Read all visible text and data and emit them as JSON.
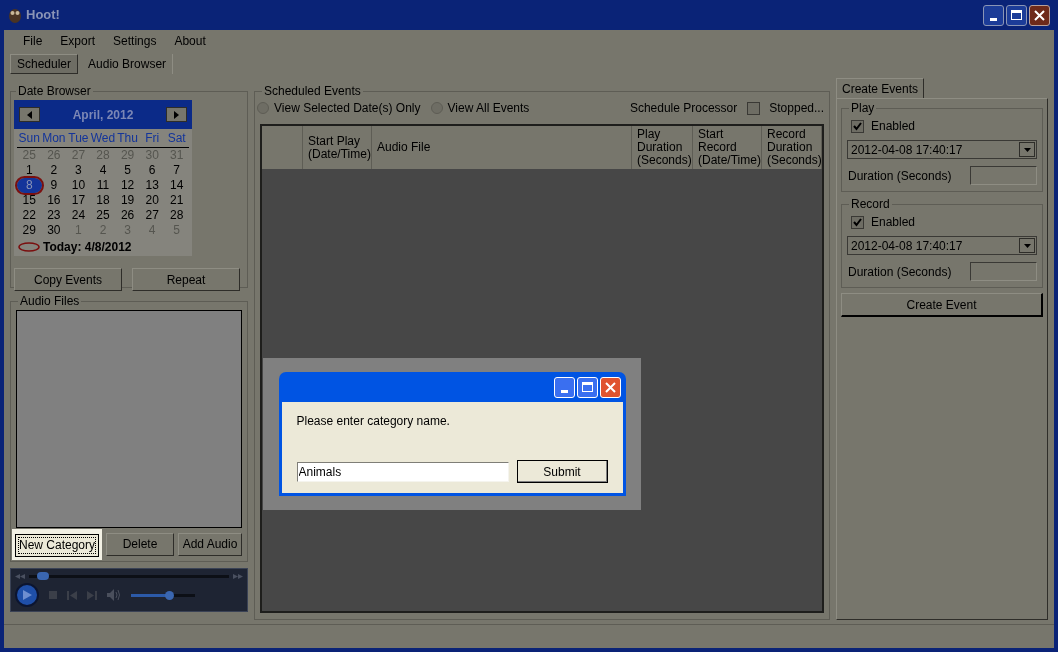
{
  "window": {
    "title": "Hoot!"
  },
  "menu": [
    "File",
    "Export",
    "Settings",
    "About"
  ],
  "tabs": [
    {
      "label": "Scheduler",
      "selected": true
    },
    {
      "label": "Audio Browser",
      "selected": false
    }
  ],
  "date_browser": {
    "title": "Date Browser",
    "month": "April, 2012",
    "weekdays": [
      "Sun",
      "Mon",
      "Tue",
      "Wed",
      "Thu",
      "Fri",
      "Sat"
    ],
    "weeks": [
      [
        {
          "day": "25",
          "muted": true,
          "selected": false
        },
        {
          "day": "26",
          "muted": true,
          "selected": false
        },
        {
          "day": "27",
          "muted": true,
          "selected": false
        },
        {
          "day": "28",
          "muted": true,
          "selected": false
        },
        {
          "day": "29",
          "muted": true,
          "selected": false
        },
        {
          "day": "30",
          "muted": true,
          "selected": false
        },
        {
          "day": "31",
          "muted": true,
          "selected": false
        }
      ],
      [
        {
          "day": "1",
          "muted": false,
          "selected": false
        },
        {
          "day": "2",
          "muted": false,
          "selected": false
        },
        {
          "day": "3",
          "muted": false,
          "selected": false
        },
        {
          "day": "4",
          "muted": false,
          "selected": false
        },
        {
          "day": "5",
          "muted": false,
          "selected": false
        },
        {
          "day": "6",
          "muted": false,
          "selected": false
        },
        {
          "day": "7",
          "muted": false,
          "selected": false
        }
      ],
      [
        {
          "day": "8",
          "muted": false,
          "selected": true
        },
        {
          "day": "9",
          "muted": false,
          "selected": false
        },
        {
          "day": "10",
          "muted": false,
          "selected": false
        },
        {
          "day": "11",
          "muted": false,
          "selected": false
        },
        {
          "day": "12",
          "muted": false,
          "selected": false
        },
        {
          "day": "13",
          "muted": false,
          "selected": false
        },
        {
          "day": "14",
          "muted": false,
          "selected": false
        }
      ],
      [
        {
          "day": "15",
          "muted": false,
          "selected": false
        },
        {
          "day": "16",
          "muted": false,
          "selected": false
        },
        {
          "day": "17",
          "muted": false,
          "selected": false
        },
        {
          "day": "18",
          "muted": false,
          "selected": false
        },
        {
          "day": "19",
          "muted": false,
          "selected": false
        },
        {
          "day": "20",
          "muted": false,
          "selected": false
        },
        {
          "day": "21",
          "muted": false,
          "selected": false
        }
      ],
      [
        {
          "day": "22",
          "muted": false,
          "selected": false
        },
        {
          "day": "23",
          "muted": false,
          "selected": false
        },
        {
          "day": "24",
          "muted": false,
          "selected": false
        },
        {
          "day": "25",
          "muted": false,
          "selected": false
        },
        {
          "day": "26",
          "muted": false,
          "selected": false
        },
        {
          "day": "27",
          "muted": false,
          "selected": false
        },
        {
          "day": "28",
          "muted": false,
          "selected": false
        }
      ],
      [
        {
          "day": "29",
          "muted": false,
          "selected": false
        },
        {
          "day": "30",
          "muted": false,
          "selected": false
        },
        {
          "day": "1",
          "muted": true,
          "selected": false
        },
        {
          "day": "2",
          "muted": true,
          "selected": false
        },
        {
          "day": "3",
          "muted": true,
          "selected": false
        },
        {
          "day": "4",
          "muted": true,
          "selected": false
        },
        {
          "day": "5",
          "muted": true,
          "selected": false
        }
      ]
    ],
    "today": "Today: 4/8/2012",
    "buttons": [
      "Copy Events",
      "Repeat"
    ]
  },
  "audio_files": {
    "title": "Audio Files",
    "buttons": [
      {
        "label": "New Category",
        "highlighted": true
      },
      {
        "label": "Delete",
        "highlighted": false
      },
      {
        "label": "Add Audio",
        "highlighted": false
      }
    ]
  },
  "player": {
    "seek": {
      "level": 0.05
    },
    "volume": {
      "level": 0.6
    }
  },
  "scheduled_events": {
    "title": "Scheduled Events",
    "filters": [
      {
        "label": "View Selected Date(s) Only",
        "selected": false
      },
      {
        "label": "View All Events",
        "selected": false
      }
    ],
    "processor_label": "Schedule Processor",
    "stopped": {
      "label": "Stopped...",
      "checked": false
    },
    "columns": [
      "Start Play (Date/Time)",
      "Audio File",
      "Play Duration (Seconds)",
      "Start Record (Date/Time)",
      "Record Duration (Seconds)"
    ]
  },
  "create_events": {
    "tab": {
      "label": "Create Events"
    },
    "groups": [
      {
        "title": "Play",
        "enabled": {
          "label": "Enabled",
          "checked": true
        },
        "datetime": "2012-04-08 17:40:17",
        "duration_label": "Duration (Seconds)"
      },
      {
        "title": "Record",
        "enabled": {
          "label": "Enabled",
          "checked": true
        },
        "datetime": "2012-04-08 17:40:17",
        "duration_label": "Duration (Seconds)"
      }
    ],
    "button": "Create Event"
  },
  "dialog": {
    "message": "Please enter category name.",
    "value": "Animals",
    "button": "Submit"
  }
}
